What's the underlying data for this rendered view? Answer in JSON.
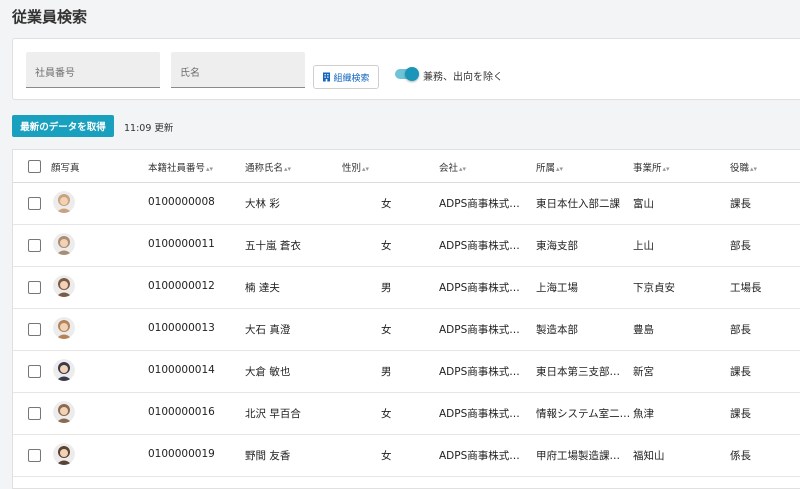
{
  "page": {
    "title": "従業員検索"
  },
  "search": {
    "employee_no_placeholder": "社員番号",
    "name_placeholder": "氏名",
    "org_search_label": "組織検索",
    "exclude_toggle_label": "兼務、出向を除く",
    "exclude_toggle_on": true
  },
  "actions": {
    "fetch_label": "最新のデータを取得",
    "updated_text": "11:09 更新"
  },
  "table": {
    "headers": {
      "photo": "顔写真",
      "emp_no": "本籍社員番号",
      "name": "通称氏名",
      "gender": "性別",
      "company": "会社",
      "dept": "所属",
      "office": "事業所",
      "role": "役職"
    },
    "rows": [
      {
        "emp_no": "0100000008",
        "name": "大林 彩",
        "gender": "女",
        "company": "ADPS商事株式…",
        "dept": "東日本仕入部二課",
        "office": "富山",
        "role": "課長",
        "avatar_color": "#c9a27e"
      },
      {
        "emp_no": "0100000011",
        "name": "五十嵐 蒼衣",
        "gender": "女",
        "company": "ADPS商事株式…",
        "dept": "東海支部",
        "office": "上山",
        "role": "部長",
        "avatar_color": "#a98d72"
      },
      {
        "emp_no": "0100000012",
        "name": "楠 達夫",
        "gender": "男",
        "company": "ADPS商事株式…",
        "dept": "上海工場",
        "office": "下京貞安",
        "role": "工場長",
        "avatar_color": "#7d5a45"
      },
      {
        "emp_no": "0100000013",
        "name": "大石 真澄",
        "gender": "女",
        "company": "ADPS商事株式…",
        "dept": "製造本部",
        "office": "豊島",
        "role": "部長",
        "avatar_color": "#b5835a"
      },
      {
        "emp_no": "0100000014",
        "name": "大倉 敏也",
        "gender": "男",
        "company": "ADPS商事株式…",
        "dept": "東日本第三支部…",
        "office": "新宮",
        "role": "課長",
        "avatar_color": "#3a3a4a"
      },
      {
        "emp_no": "0100000016",
        "name": "北沢 早百合",
        "gender": "女",
        "company": "ADPS商事株式…",
        "dept": "情報システム室二…",
        "office": "魚津",
        "role": "課長",
        "avatar_color": "#8c6a4f"
      },
      {
        "emp_no": "0100000019",
        "name": "野間 友香",
        "gender": "女",
        "company": "ADPS商事株式…",
        "dept": "甲府工場製造課…",
        "office": "福知山",
        "role": "係長",
        "avatar_color": "#5b4334"
      }
    ]
  }
}
